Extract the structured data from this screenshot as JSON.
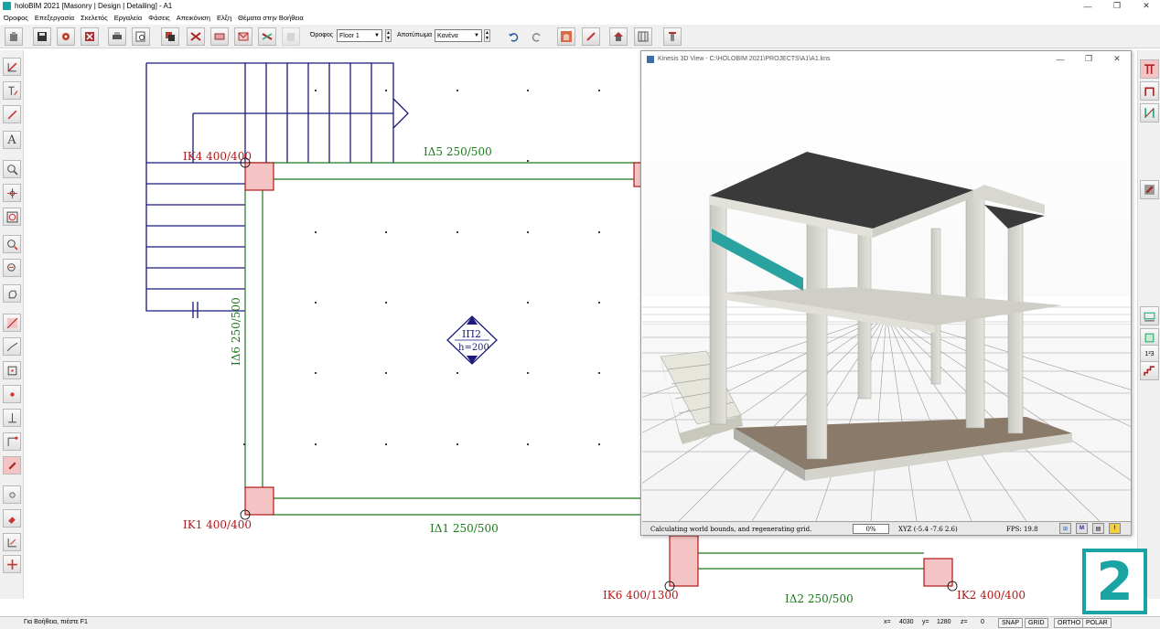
{
  "app": {
    "title": "holoBIM 2021 [Masonry | Design | Detailing] - A1"
  },
  "window_controls": {
    "minimize": "—",
    "maximize": "❐",
    "close": "✕"
  },
  "menu": [
    "Όροφος",
    "Επεξεργασία",
    "Σκελετός",
    "Εργαλεία",
    "Φάσεις",
    "Απεικόνιση",
    "Ελξη",
    "Θέματα στην Βοήθεια"
  ],
  "toolbar": {
    "floor_label": "Όροφος",
    "floor_value": "Floor 1",
    "section_label": "Αποτύπωμα",
    "section_value": "Κανένα"
  },
  "plan": {
    "columns": [
      {
        "label": "ΙΚ4 400/400"
      },
      {
        "label": "ΙΚ1 400/400"
      },
      {
        "label": "ΙΚ6 400/1300"
      },
      {
        "label": "ΙΚ2 400/400"
      }
    ],
    "beams": [
      {
        "label": "ΙΔ5 250/500"
      },
      {
        "label": "ΙΔ6 250/500"
      },
      {
        "label": "ΙΔ1 250/500"
      },
      {
        "label": "ΙΔ2 250/500"
      }
    ],
    "slab": {
      "name": "ΙΠ2",
      "thickness": "h=200"
    }
  },
  "view3d": {
    "title": "Kinesis 3D View - C:\\HOLOBIM 2021\\PROJECTS\\A1\\A1.kns",
    "status_message": "Calculating world bounds, and regenerating grid.",
    "progress": "0%",
    "progress_value": 0,
    "coords": "XYZ (-5.4 -7.6 2.6)",
    "fps": "FPS: 19.8",
    "icons": [
      "lock-icon",
      "m-icon",
      "grid-icon",
      "warning-icon"
    ],
    "icon_labels": [
      "⊞",
      "M",
      "▤",
      "!"
    ]
  },
  "statusbar": {
    "help": "Για Βοήθεια, πιέστε F1",
    "x_label": "x=",
    "x_value": "4030",
    "y_label": "y=",
    "y_value": "1280",
    "z_label": "z=",
    "z_value": "0",
    "flags": [
      "SNAP",
      "GRID",
      "ORTHO",
      "POLAR"
    ]
  },
  "badge": "2",
  "colors": {
    "accent": "#1aa3a3",
    "plan_lines": "#1a1a7a",
    "beams": "#1a7a1a",
    "columns_fill": "#f4c4c4",
    "columns_stroke": "#b01818"
  }
}
